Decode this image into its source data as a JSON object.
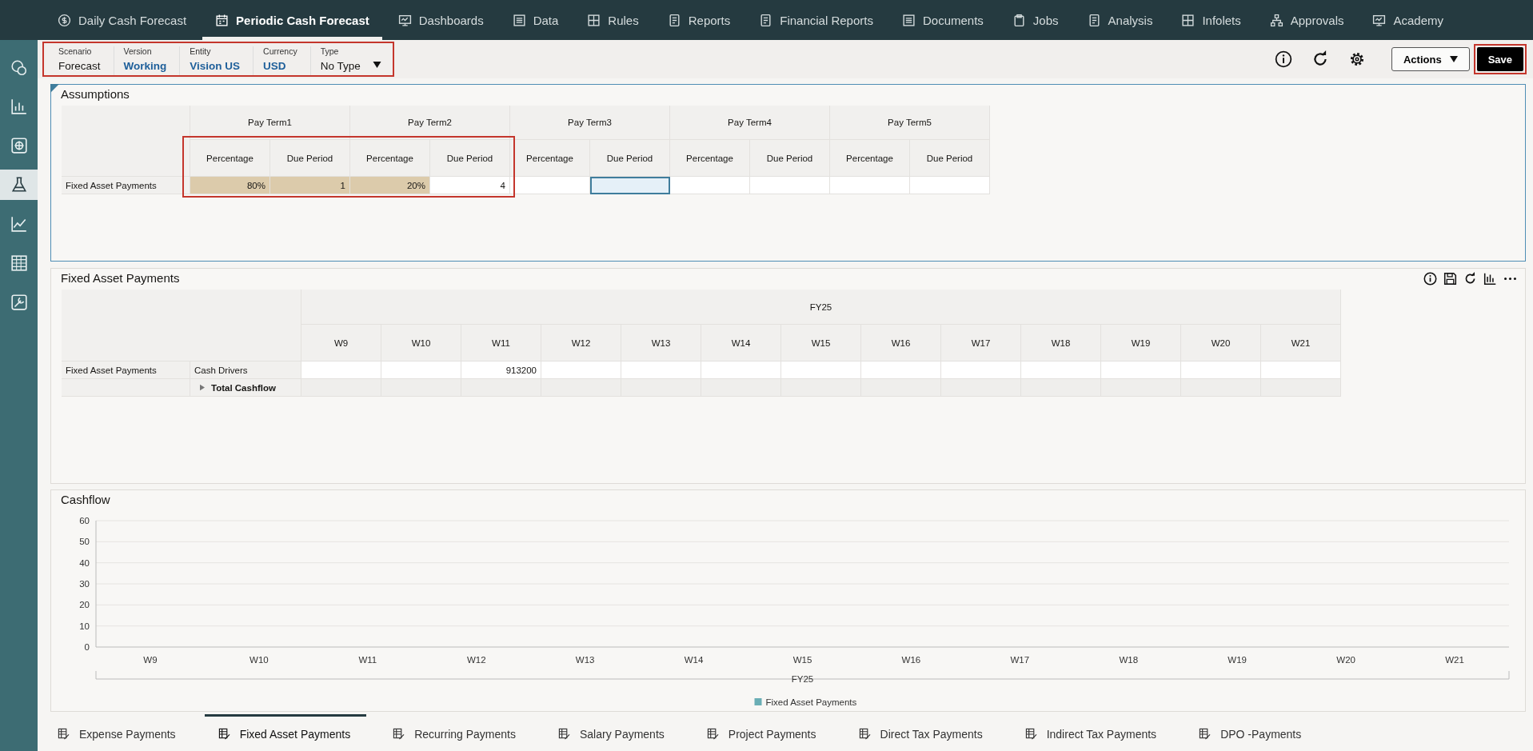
{
  "nav": {
    "items": [
      {
        "label": "Daily Cash Forecast",
        "selected": false
      },
      {
        "label": "Periodic Cash Forecast",
        "selected": true
      },
      {
        "label": "Dashboards",
        "selected": false
      },
      {
        "label": "Data",
        "selected": false
      },
      {
        "label": "Rules",
        "selected": false
      },
      {
        "label": "Reports",
        "selected": false
      },
      {
        "label": "Financial Reports",
        "selected": false
      },
      {
        "label": "Documents",
        "selected": false
      },
      {
        "label": "Jobs",
        "selected": false
      },
      {
        "label": "Analysis",
        "selected": false
      },
      {
        "label": "Infolets",
        "selected": false
      },
      {
        "label": "Approvals",
        "selected": false
      },
      {
        "label": "Academy",
        "selected": false
      }
    ]
  },
  "sidebar": {
    "items": [
      {
        "selected": false
      },
      {
        "selected": false
      },
      {
        "selected": false
      },
      {
        "selected": true
      },
      {
        "selected": false
      },
      {
        "selected": false
      },
      {
        "selected": false
      }
    ]
  },
  "pov": {
    "highlighted": true,
    "members": [
      {
        "label": "Scenario",
        "value": "Forecast",
        "kind": "plain"
      },
      {
        "label": "Version",
        "value": "Working",
        "kind": "link"
      },
      {
        "label": "Entity",
        "value": "Vision US",
        "kind": "link"
      },
      {
        "label": "Currency",
        "value": "USD",
        "kind": "link"
      },
      {
        "label": "Type",
        "value": "No Type",
        "kind": "dropdown"
      }
    ]
  },
  "toolbar": {
    "actions": "Actions",
    "save": {
      "label": "Save",
      "highlighted": true
    }
  },
  "assumptions": {
    "title": "Assumptions",
    "terms": [
      {
        "label": "Pay Term1",
        "highlighted": true,
        "columns": [
          "Percentage",
          "Due Period"
        ]
      },
      {
        "label": "Pay Term2",
        "highlighted": true,
        "columns": [
          "Percentage",
          "Due Period"
        ]
      },
      {
        "label": "Pay Term3",
        "highlighted": false,
        "columns": [
          "Percentage",
          "Due Period"
        ]
      },
      {
        "label": "Pay Term4",
        "highlighted": false,
        "columns": [
          "Percentage",
          "Due Period"
        ]
      },
      {
        "label": "Pay Term5",
        "highlighted": false,
        "columns": [
          "Percentage",
          "Due Period"
        ]
      }
    ],
    "rows": [
      {
        "label": "Fixed Asset Payments",
        "cells": [
          {
            "value": "80%",
            "shaded": true,
            "selected": false
          },
          {
            "value": "1",
            "shaded": true,
            "selected": false
          },
          {
            "value": "20%",
            "shaded": true,
            "selected": false
          },
          {
            "value": "4",
            "shaded": false,
            "selected": false
          },
          {
            "shaded": false,
            "selected": false
          },
          {
            "shaded": false,
            "selected": true
          },
          {
            "shaded": false,
            "selected": false
          },
          {
            "shaded": false,
            "selected": false
          },
          {
            "shaded": false,
            "selected": false
          },
          {
            "shaded": false,
            "selected": false
          }
        ]
      }
    ]
  },
  "fixed_asset_payments": {
    "title": "Fixed Asset Payments",
    "year": "FY25",
    "weeks": [
      "W9",
      "W10",
      "W11",
      "W12",
      "W13",
      "W14",
      "W15",
      "W16",
      "W17",
      "W18",
      "W19",
      "W20",
      "W21"
    ],
    "rows": [
      {
        "kind": "data",
        "label": "Fixed Asset Payments",
        "member": "Cash Drivers",
        "cells": [
          null,
          null,
          "913200",
          null,
          null,
          null,
          null,
          null,
          null,
          null,
          null,
          null,
          null
        ]
      },
      {
        "kind": "total",
        "member": "Total Cashflow",
        "expanded": false,
        "cells": [
          null,
          null,
          null,
          null,
          null,
          null,
          null,
          null,
          null,
          null,
          null,
          null,
          null
        ]
      }
    ]
  },
  "cashflow": {
    "title": "Cashflow",
    "chart_data": {
      "type": "bar",
      "categories": [
        "W9",
        "W10",
        "W11",
        "W12",
        "W13",
        "W14",
        "W15",
        "W16",
        "W17",
        "W18",
        "W19",
        "W20",
        "W21"
      ],
      "series": [
        {
          "name": "Fixed Asset Payments",
          "color": "#6aaeb5",
          "values": [
            0,
            0,
            0,
            0,
            0,
            0,
            0,
            0,
            0,
            0,
            0,
            0,
            0
          ]
        }
      ],
      "xlabel": "FY25",
      "grid": true,
      "ylim": [
        0,
        60
      ],
      "yticks": [
        0,
        10,
        20,
        30,
        40,
        50,
        60
      ]
    }
  },
  "bottom_tabs": [
    {
      "label": "Expense Payments",
      "selected": false
    },
    {
      "label": "Fixed Asset Payments",
      "selected": true
    },
    {
      "label": "Recurring Payments",
      "selected": false
    },
    {
      "label": "Salary Payments",
      "selected": false
    },
    {
      "label": "Project Payments",
      "selected": false
    },
    {
      "label": "Direct Tax Payments",
      "selected": false
    },
    {
      "label": "Indirect Tax Payments",
      "selected": false
    },
    {
      "label": "DPO -Payments",
      "selected": false
    }
  ]
}
